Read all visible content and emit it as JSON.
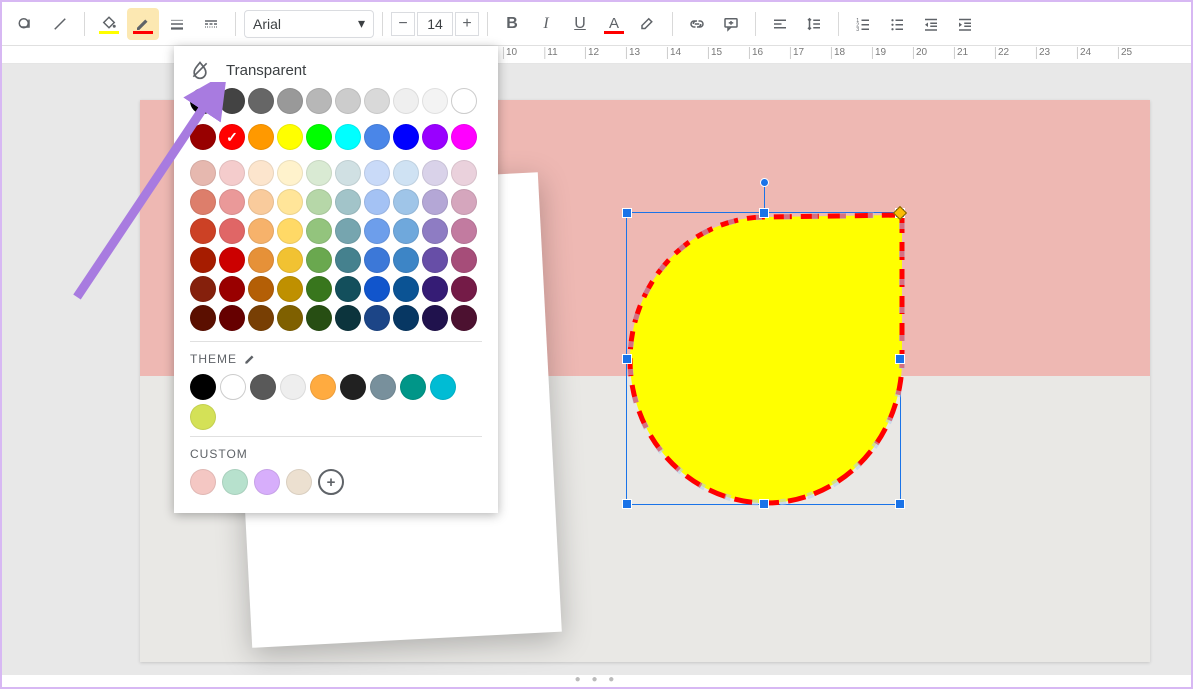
{
  "toolbar": {
    "font_name": "Arial",
    "font_size": "14",
    "fill_color": "#ffff00",
    "border_color": "#ff0000",
    "text_color": "#ff0000"
  },
  "ruler": {
    "ticks": [
      10,
      11,
      12,
      13,
      14,
      15,
      16,
      17,
      18,
      19,
      20,
      21,
      22,
      23,
      24,
      25
    ]
  },
  "popover": {
    "transparent_label": "Transparent",
    "theme_label": "THEME",
    "custom_label": "CUSTOM",
    "gray_row": [
      "#000000",
      "#434343",
      "#666666",
      "#999999",
      "#b7b7b7",
      "#cccccc",
      "#d9d9d9",
      "#efefef",
      "#f3f3f3",
      "#ffffff"
    ],
    "standard_row": [
      "#980000",
      "#ff0000",
      "#ff9900",
      "#ffff00",
      "#00ff00",
      "#00ffff",
      "#4a86e8",
      "#0000ff",
      "#9900ff",
      "#ff00ff"
    ],
    "checked_color": "#ff0000",
    "shades": [
      [
        "#e6b8af",
        "#f4cccc",
        "#fce5cd",
        "#fff2cc",
        "#d9ead3",
        "#d0e0e3",
        "#c9daf8",
        "#cfe2f3",
        "#d9d2e9",
        "#ead1dc"
      ],
      [
        "#dd7e6b",
        "#ea9999",
        "#f9cb9c",
        "#ffe599",
        "#b6d7a8",
        "#a2c4c9",
        "#a4c2f4",
        "#9fc5e8",
        "#b4a7d6",
        "#d5a6bd"
      ],
      [
        "#cc4125",
        "#e06666",
        "#f6b26b",
        "#ffd966",
        "#93c47d",
        "#76a5af",
        "#6d9eeb",
        "#6fa8dc",
        "#8e7cc3",
        "#c27ba0"
      ],
      [
        "#a61c00",
        "#cc0000",
        "#e69138",
        "#f1c232",
        "#6aa84f",
        "#45818e",
        "#3c78d8",
        "#3d85c6",
        "#674ea7",
        "#a64d79"
      ],
      [
        "#85200c",
        "#990000",
        "#b45f06",
        "#bf9000",
        "#38761d",
        "#134f5c",
        "#1155cc",
        "#0b5394",
        "#351c75",
        "#741b47"
      ],
      [
        "#5b0f00",
        "#660000",
        "#783f04",
        "#7f6000",
        "#274e13",
        "#0c343d",
        "#1c4587",
        "#073763",
        "#20124d",
        "#4c1130"
      ]
    ],
    "theme_colors": [
      "#000000",
      "#ffffff",
      "#595959",
      "#eeeeee",
      "#ffab40",
      "#212121",
      "#78909c",
      "#009688",
      "#00bcd4",
      "#d4e157"
    ],
    "custom_colors": [
      "#f4c7c3",
      "#b7e1cd",
      "#d7aefb",
      "#ece0d0"
    ]
  }
}
